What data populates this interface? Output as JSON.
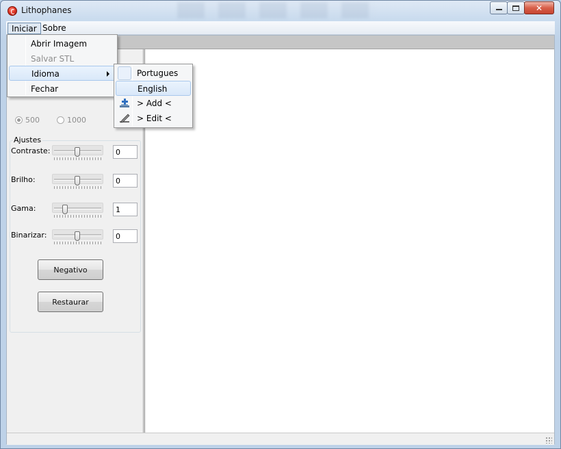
{
  "window": {
    "title": "Lithophanes",
    "icon": "lithophanes-app-icon"
  },
  "menubar": {
    "items": [
      {
        "label": "Iniciar",
        "active": true
      },
      {
        "label": "Sobre",
        "active": false
      }
    ]
  },
  "iniciar_menu": {
    "items": [
      {
        "label": "Abrir Imagem",
        "enabled": true
      },
      {
        "label": "Salvar STL",
        "enabled": false
      },
      {
        "label": "Idioma",
        "enabled": true,
        "has_submenu": true,
        "highlighted": true
      },
      {
        "label": "Fechar",
        "enabled": true
      }
    ]
  },
  "idioma_submenu": {
    "items": [
      {
        "label": "Portugues",
        "checked": true,
        "icon": "check-icon"
      },
      {
        "label": "English",
        "checked": false,
        "highlighted": true
      },
      {
        "label": "> Add <",
        "icon": "add-icon"
      },
      {
        "label": "> Edit <",
        "icon": "edit-icon"
      }
    ]
  },
  "resolution": {
    "options": [
      {
        "label": "500",
        "selected": true
      },
      {
        "label": "1000",
        "selected": false
      }
    ]
  },
  "ajustes": {
    "title": "Ajustes",
    "sliders": [
      {
        "label": "Contraste:",
        "value": "0",
        "position": 0.5
      },
      {
        "label": "Brilho:",
        "value": "0",
        "position": 0.5
      },
      {
        "label": "Gama:",
        "value": "1",
        "position": 0.22
      },
      {
        "label": "Binarizar:",
        "value": "0",
        "position": 0.5
      }
    ]
  },
  "buttons": {
    "negativo": "Negativo",
    "restaurar": "Restaurar"
  },
  "colors": {
    "menu_highlight": "#d9e8f9",
    "close_button": "#c74430",
    "titlebar": "#c9dbee"
  }
}
